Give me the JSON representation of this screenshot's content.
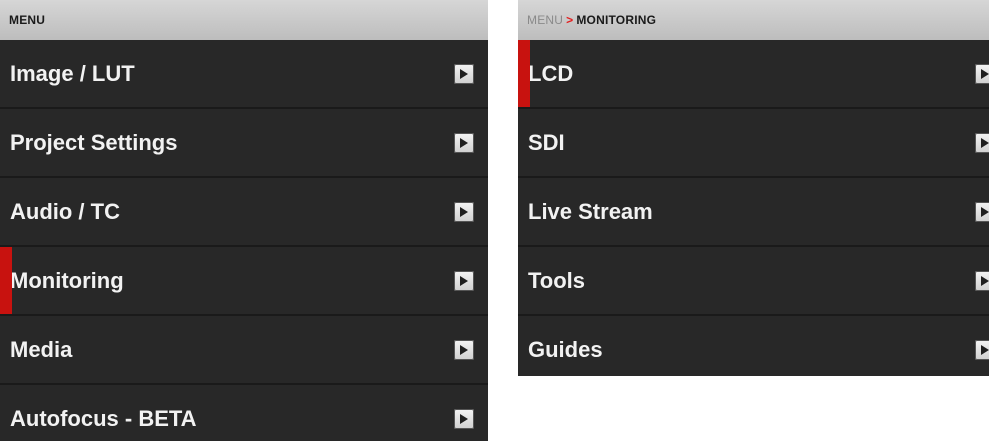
{
  "left_menu": {
    "header": "MENU",
    "items": [
      {
        "label": "Image / LUT",
        "selected": false
      },
      {
        "label": "Project Settings",
        "selected": false
      },
      {
        "label": "Audio / TC",
        "selected": false
      },
      {
        "label": "Monitoring",
        "selected": true
      },
      {
        "label": "Media",
        "selected": false
      },
      {
        "label": "Autofocus - BETA",
        "selected": false
      }
    ]
  },
  "right_menu": {
    "breadcrumb": {
      "parent": "MENU",
      "separator": ">",
      "current": "MONITORING"
    },
    "items": [
      {
        "label": "LCD",
        "selected": true
      },
      {
        "label": "SDI",
        "selected": false
      },
      {
        "label": "Live Stream",
        "selected": false
      },
      {
        "label": "Tools",
        "selected": false
      },
      {
        "label": "Guides",
        "selected": false
      }
    ]
  },
  "icons": {
    "item_arrow": "chevron-right-icon"
  },
  "colors": {
    "selection_indicator": "#c8120f",
    "breadcrumb_separator": "#e31b1b",
    "panel_background": "#262626",
    "header_background": "#c9c9c9"
  }
}
